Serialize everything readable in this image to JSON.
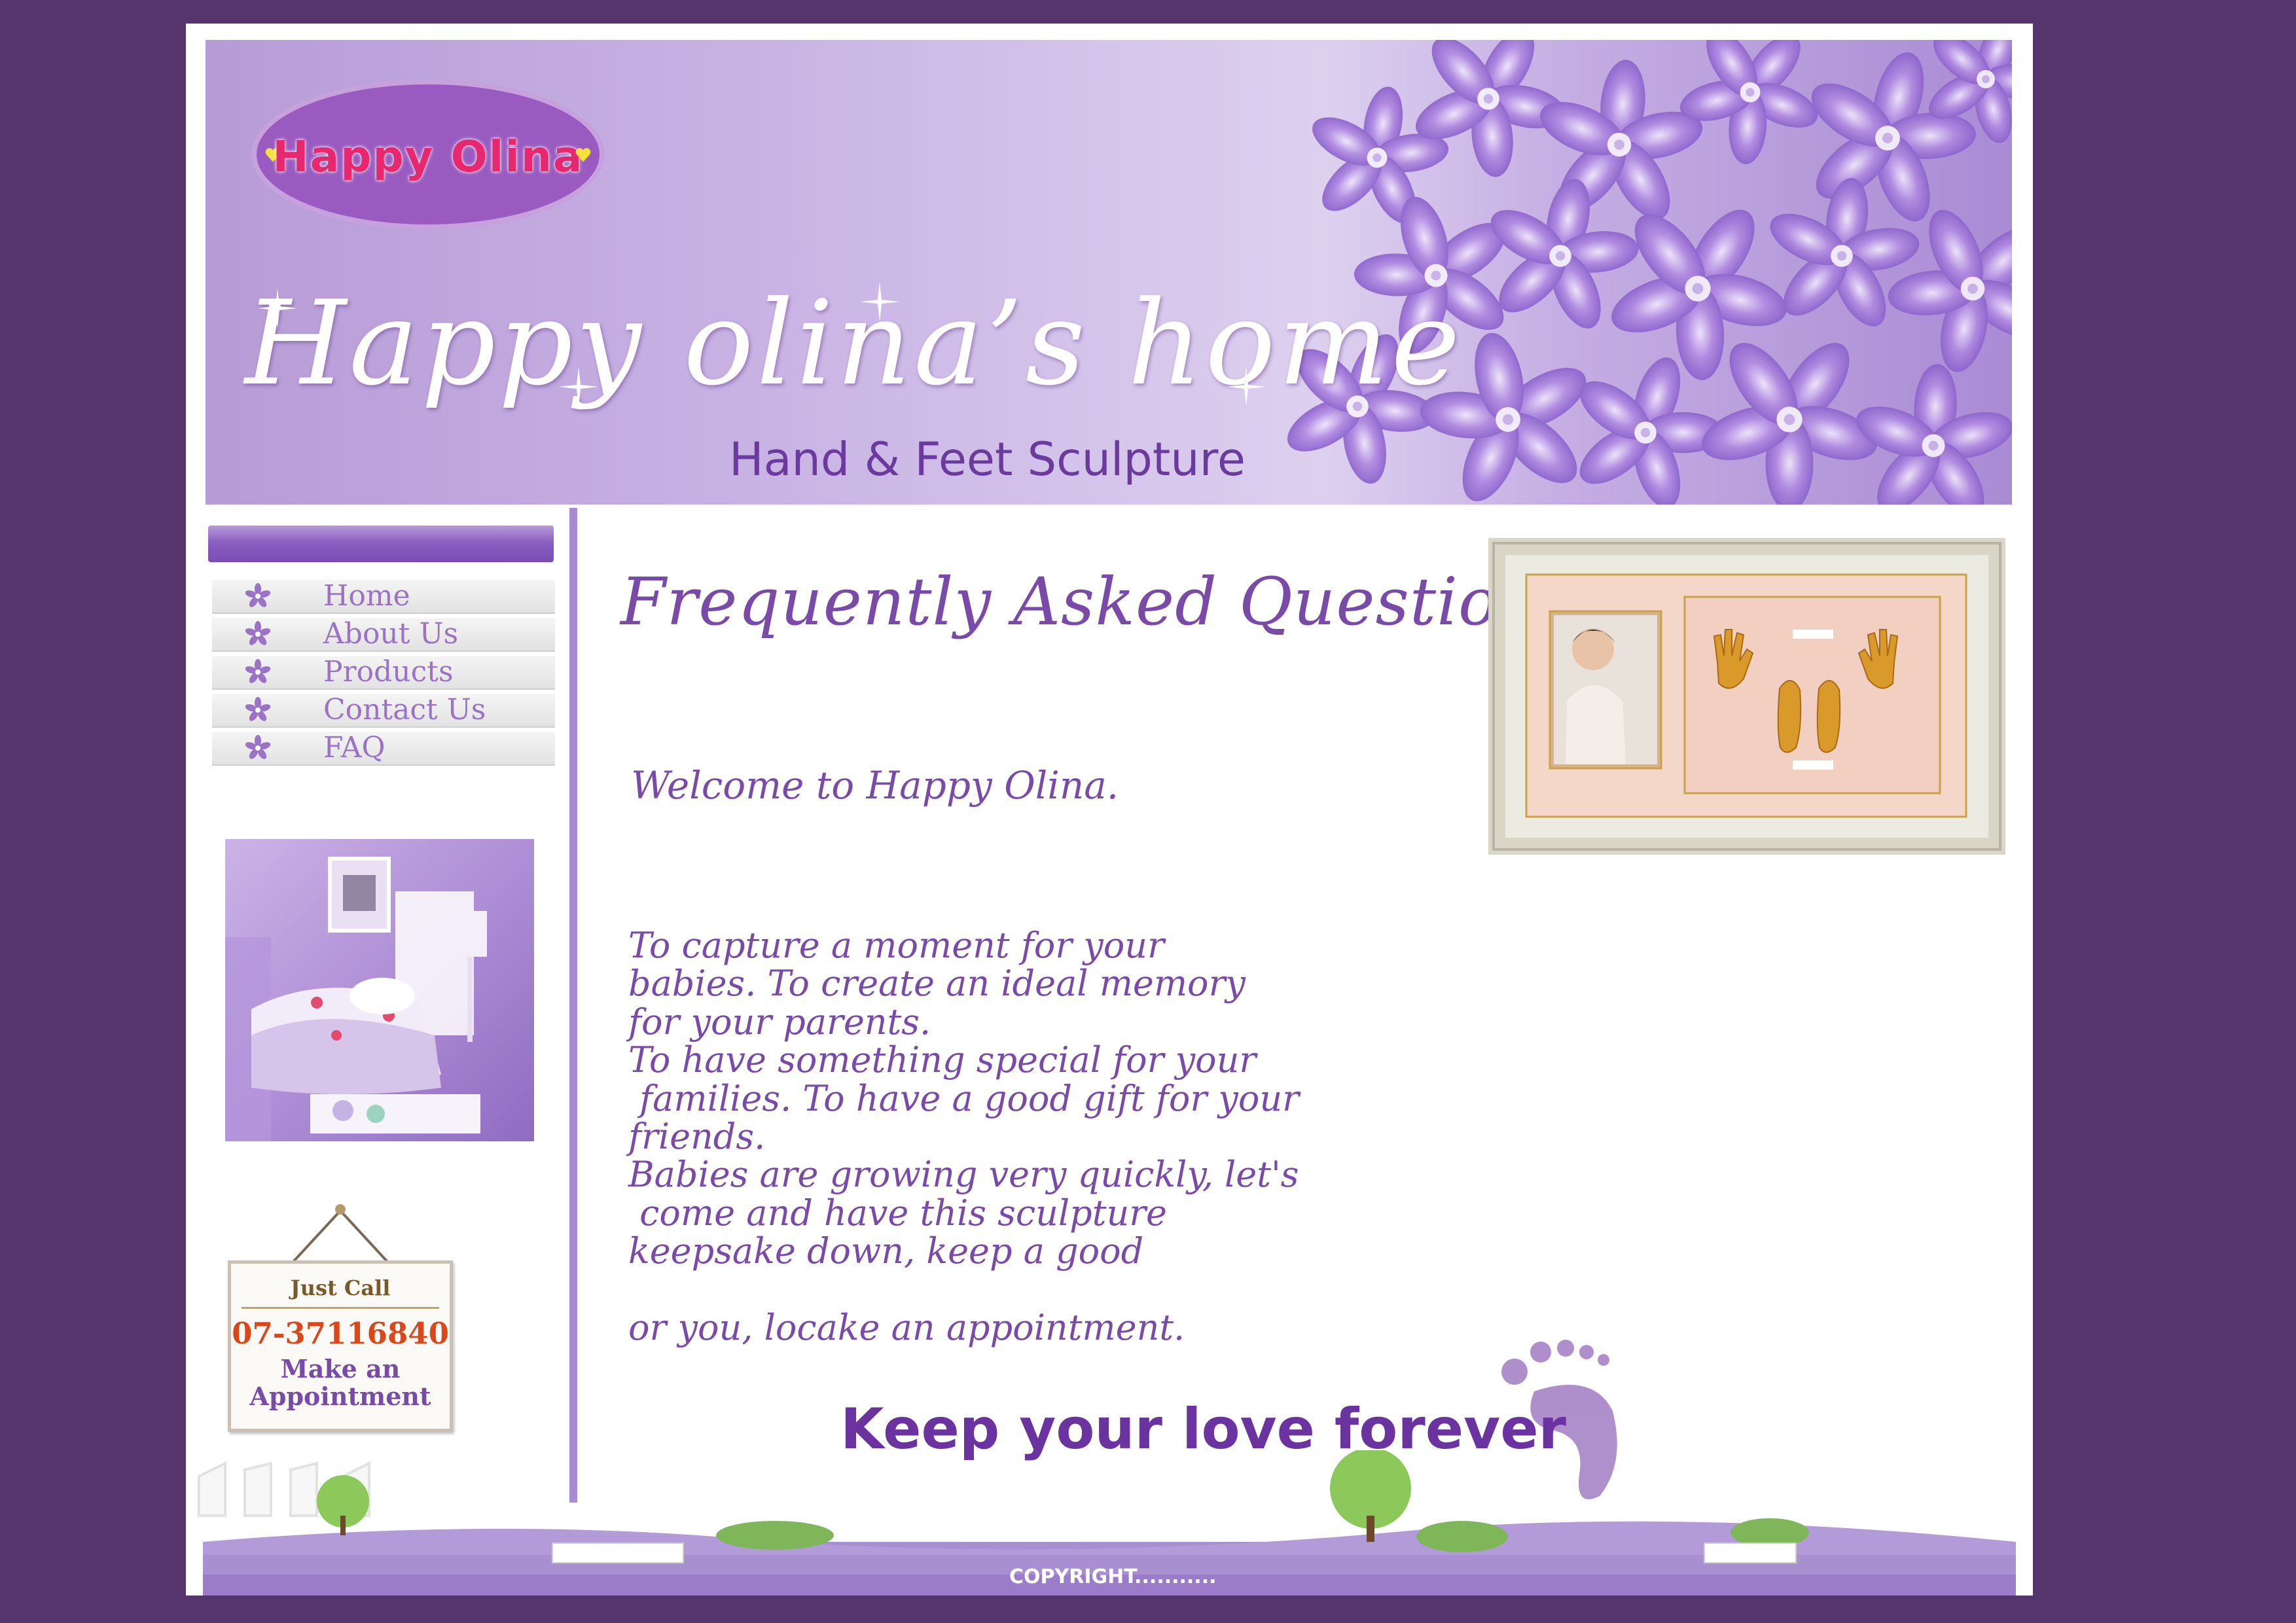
{
  "banner": {
    "logo_text": "Happy Olina",
    "title": "Happy olina’s home",
    "subtitle": "Hand & Feet Sculpture"
  },
  "nav": {
    "items": [
      {
        "label": "Home",
        "icon": "flower-icon"
      },
      {
        "label": "About Us",
        "icon": "flower-icon"
      },
      {
        "label": "Products",
        "icon": "flower-icon"
      },
      {
        "label": "Contact Us",
        "icon": "flower-icon"
      },
      {
        "label": "FAQ",
        "icon": "flower-icon"
      }
    ]
  },
  "sidebar": {
    "call_card": {
      "heading": "Just Call",
      "phone": "07-37116840",
      "line1": "Make an",
      "line2": "Appointment"
    }
  },
  "main": {
    "title": "Frequently Asked Questions",
    "welcome": "Welcome to Happy Olina.",
    "body_lines": [
      "To capture a moment for your",
      "babies. To create an ideal memory",
      "for your parents.",
      "To have something special for your",
      " families. To have a good gift for your",
      "friends.",
      "Babies are growing very quickly, let's",
      " come and have this sculpture",
      "keepsake down, keep a good",
      "",
      "or you, locake an appointment."
    ],
    "tagline": "Keep your love forever"
  },
  "footer": {
    "copyright": "COPYRIGHT..........."
  },
  "colors": {
    "page_background": "#55356b",
    "accent_purple": "#7a4aa8",
    "nav_text": "#9a72c6",
    "phone_orange": "#d9471b"
  }
}
